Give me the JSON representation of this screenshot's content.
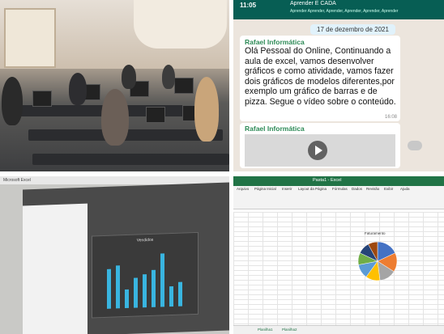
{
  "whatsapp": {
    "status_time": "11:05",
    "chat_title": "Aprender E CADA",
    "chat_subtitle": "Aprender Aprender, Aprender, Aprender, Aprender, Aprender",
    "date_chip": "17 de dezembro de 2021",
    "message": {
      "sender": "Rafael Informática",
      "text": "Olá Pessoal do Online, Continuando a aula de excel, vamos desenvolver gráficos e como atividade, vamos fazer dois gráficos de modelos diferentes,por exemplo um gráfico de barras e de pizza. Segue o vídeo sobre o conteúdo.",
      "time": "16:08"
    },
    "video_message": {
      "sender": "Rafael Informática"
    }
  },
  "excel_monitor": {
    "titlebar": "Microsoft Excel",
    "chart_title": "Vendidos"
  },
  "excel_screenshot": {
    "window_title": "Pasta1 - Excel",
    "ribbon_tabs": [
      "Arquivo",
      "Página Inicial",
      "Inserir",
      "Layout da Página",
      "Fórmulas",
      "Dados",
      "Revisão",
      "Exibir",
      "Ajuda"
    ],
    "pie_title": "Faturamento",
    "sheet_tabs": [
      "Planilha1",
      "Planilha2"
    ]
  },
  "chart_data": [
    {
      "type": "bar",
      "title": "Vendidos",
      "categories": [],
      "values": [
        68,
        74,
        32,
        52,
        57,
        64,
        91,
        35,
        41
      ],
      "xlabel": "",
      "ylabel": "",
      "colors": [
        "#39b5e0"
      ]
    },
    {
      "type": "pie",
      "title": "Faturamento",
      "values": [
        18,
        16,
        14,
        12,
        12,
        10,
        10,
        8
      ],
      "colors": [
        "#4472c4",
        "#ed7d31",
        "#a5a5a5",
        "#ffc000",
        "#5b9bd5",
        "#70ad47",
        "#264478",
        "#9e480e"
      ]
    }
  ]
}
